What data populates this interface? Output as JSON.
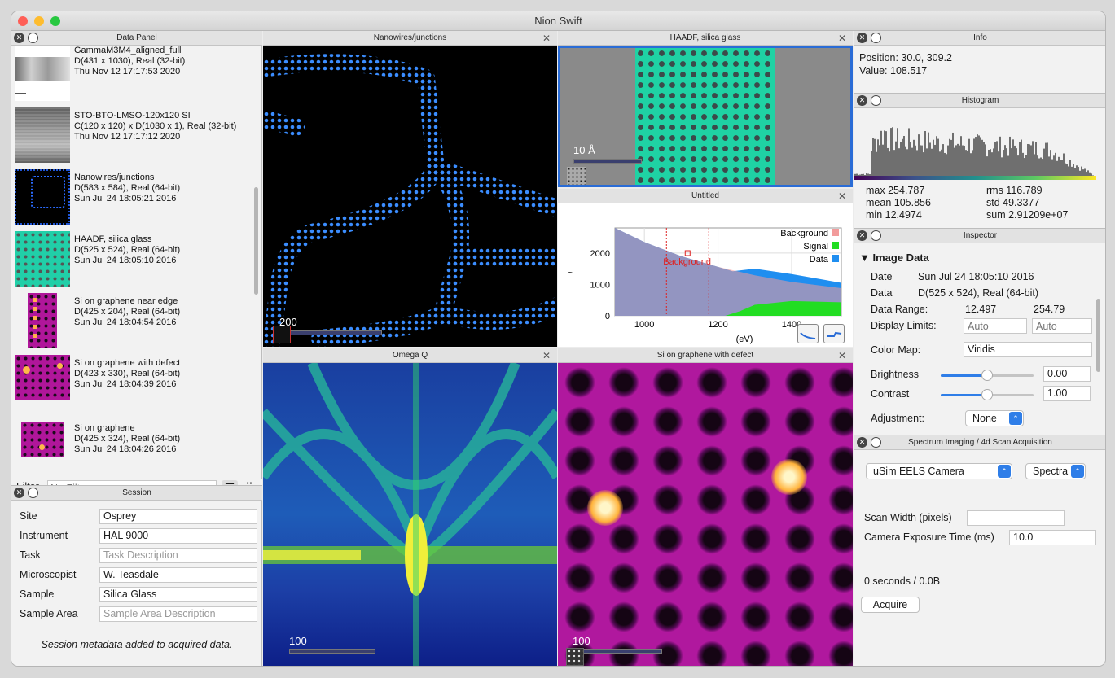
{
  "window": {
    "title": "Nion Swift"
  },
  "data_panel": {
    "title": "Data Panel",
    "items": [
      {
        "name": "GammaM3M4_aligned_full",
        "desc": "D(431 x 1030), Real (32-bit)",
        "date": "Thu Nov 12 17:17:53 2020"
      },
      {
        "name": "STO-BTO-LMSO-120x120 SI",
        "desc": "C(120 x 120) x D(1030 x 1), Real (32-bit)",
        "date": "Thu Nov 12 17:17:12 2020"
      },
      {
        "name": "Nanowires/junctions",
        "desc": "D(583 x 584), Real (64-bit)",
        "date": "Sun Jul 24 18:05:21 2016"
      },
      {
        "name": "HAADF, silica glass",
        "desc": "D(525 x 524), Real (64-bit)",
        "date": "Sun Jul 24 18:05:10 2016"
      },
      {
        "name": "Si on graphene near edge",
        "desc": "D(425 x 204), Real (64-bit)",
        "date": "Sun Jul 24 18:04:54 2016"
      },
      {
        "name": "Si on graphene with defect",
        "desc": "D(423 x 330), Real (64-bit)",
        "date": "Sun Jul 24 18:04:39 2016"
      },
      {
        "name": "Si on graphene",
        "desc": "D(425 x 324), Real (64-bit)",
        "date": "Sun Jul 24 18:04:26 2016"
      }
    ],
    "filter_label": "Filter",
    "filter_placeholder": "No Filter"
  },
  "session": {
    "title": "Session",
    "fields": [
      {
        "label": "Site",
        "value": "Osprey",
        "placeholder": ""
      },
      {
        "label": "Instrument",
        "value": "HAL 9000",
        "placeholder": ""
      },
      {
        "label": "Task",
        "value": "",
        "placeholder": "Task Description"
      },
      {
        "label": "Microscopist",
        "value": "W. Teasdale",
        "placeholder": ""
      },
      {
        "label": "Sample",
        "value": "Silica Glass",
        "placeholder": ""
      },
      {
        "label": "Sample Area",
        "value": "",
        "placeholder": "Sample Area Description"
      }
    ],
    "note": "Session metadata added to acquired data."
  },
  "displays": {
    "nanowires": {
      "title": "Nanowires/junctions",
      "scale": "200"
    },
    "haadf": {
      "title": "HAADF, silica glass",
      "scale": "10 Å"
    },
    "untitled": {
      "title": "Untitled"
    },
    "omega": {
      "title": "Omega Q",
      "scale": "100"
    },
    "defect": {
      "title": "Si on graphene with defect",
      "scale": "100"
    }
  },
  "chart_data": {
    "type": "area",
    "xlabel": "(eV)",
    "ylabel": "~",
    "xlim": [
      920,
      1535
    ],
    "ylim": [
      0,
      2800
    ],
    "x_ticks": [
      1000,
      1200,
      1400
    ],
    "y_ticks": [
      0,
      1000,
      2000
    ],
    "legend_position": "top-right",
    "interval_label": "Background",
    "interval": [
      1060,
      1175
    ],
    "series": [
      {
        "name": "Background",
        "color": "#f29b9b",
        "x": [
          920,
          1000,
          1100,
          1200,
          1300,
          1400,
          1535
        ],
        "values": [
          2800,
          2350,
          1900,
          1560,
          1290,
          1080,
          880
        ]
      },
      {
        "name": "Signal",
        "color": "#22dd22",
        "x": [
          1220,
          1260,
          1300,
          1400,
          1535
        ],
        "values": [
          0,
          150,
          350,
          470,
          430
        ]
      },
      {
        "name": "Data",
        "color": "#1f8ef0",
        "x": [
          920,
          1000,
          1100,
          1200,
          1240,
          1300,
          1400,
          1535
        ],
        "values": [
          2800,
          2350,
          1900,
          1560,
          1420,
          1500,
          1330,
          1050
        ]
      }
    ]
  },
  "info": {
    "title": "Info",
    "position": "Position: 30.0, 309.2",
    "value": "Value: 108.517"
  },
  "histogram": {
    "title": "Histogram",
    "stats": [
      [
        "max 254.787",
        "rms 116.789"
      ],
      [
        "mean 105.856",
        "std 49.3377"
      ],
      [
        "min 12.4974",
        "sum 2.91209e+07"
      ]
    ]
  },
  "inspector": {
    "title": "Inspector",
    "section": "Image Data",
    "date_label": "Date",
    "date_value": "Sun Jul 24 18:05:10 2016",
    "data_label": "Data",
    "data_value": "D(525 x 524), Real (64-bit)",
    "range_label": "Data Range:",
    "range_min": "12.497",
    "range_max": "254.79",
    "limits_label": "Display Limits:",
    "limits_low": "Auto",
    "limits_high": "Auto",
    "colormap_label": "Color Map:",
    "colormap_value": "Viridis",
    "brightness_label": "Brightness",
    "brightness_value": "0.00",
    "brightness_level": 0.5,
    "contrast_label": "Contrast",
    "contrast_value": "1.00",
    "contrast_level": 0.5,
    "adjustment_label": "Adjustment:",
    "adjustment_value": "None"
  },
  "spectrum": {
    "title": "Spectrum Imaging / 4d Scan Acquisition",
    "camera": "uSim EELS Camera",
    "mode": "Spectra",
    "scan_width_label": "Scan Width (pixels)",
    "scan_width_value": "",
    "exposure_label": "Camera Exposure Time (ms)",
    "exposure_value": "10.0",
    "status": "0 seconds / 0.0B",
    "acquire": "Acquire"
  }
}
